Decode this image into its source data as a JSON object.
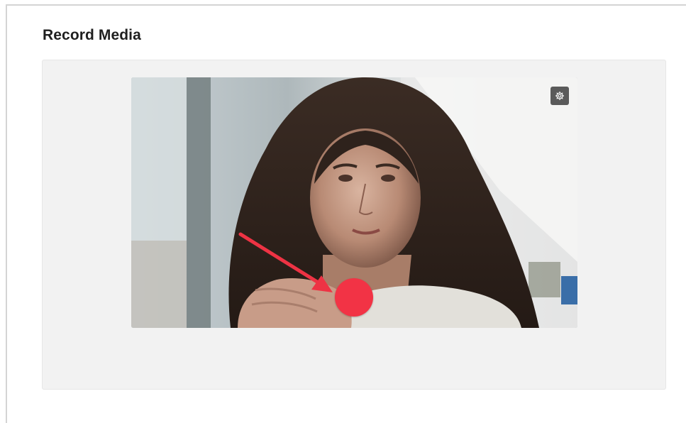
{
  "page": {
    "title": "Record Media"
  },
  "preview": {
    "settings_icon": "gear-icon",
    "record_icon": "record-circle-icon",
    "annotation_icon": "arrow-annotation-icon"
  },
  "colors": {
    "record": "#f23345",
    "arrow": "#ee3344",
    "panel_bg": "#f2f2f2",
    "settings_bg": "#5a5a5a"
  }
}
